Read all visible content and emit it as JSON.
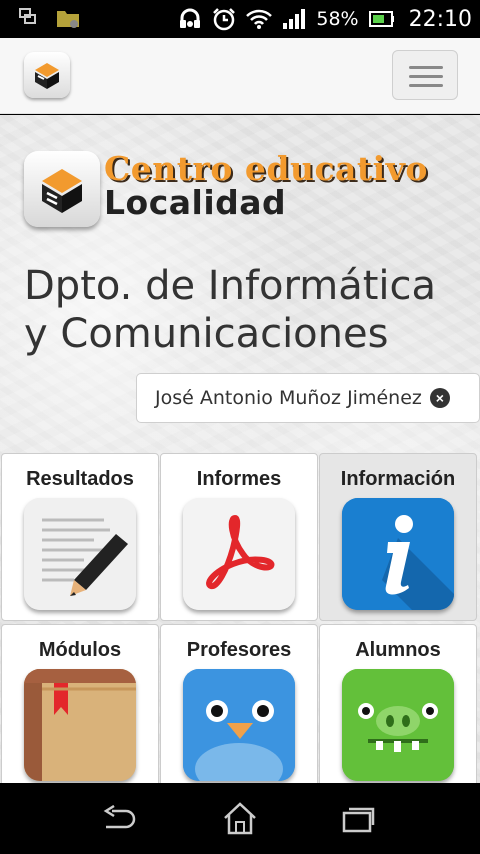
{
  "status": {
    "battery_percent": "58%",
    "time": "22:10"
  },
  "site": {
    "logo_line1": "Centro educativo",
    "logo_line2": "Localidad",
    "dept_line1": "Dpto. de Informática",
    "dept_line2": "y Comunicaciones",
    "user_name": "José Antonio Muñoz Jiménez"
  },
  "tiles": [
    {
      "label": "Resultados",
      "icon": "notepad-pencil-icon"
    },
    {
      "label": "Informes",
      "icon": "pdf-icon"
    },
    {
      "label": "Información",
      "icon": "info-icon",
      "active": true
    },
    {
      "label": "Módulos",
      "icon": "book-icon"
    },
    {
      "label": "Profesores",
      "icon": "blue-bird-icon"
    },
    {
      "label": "Alumnos",
      "icon": "green-pig-icon"
    }
  ],
  "colors": {
    "logo_orange": "#f29a2e",
    "info_blue": "#1a7fd0",
    "pdf_red": "#e3272b",
    "pig_green": "#63c03a",
    "bird_blue": "#3c94e0",
    "book_tan": "#d9b27a"
  }
}
